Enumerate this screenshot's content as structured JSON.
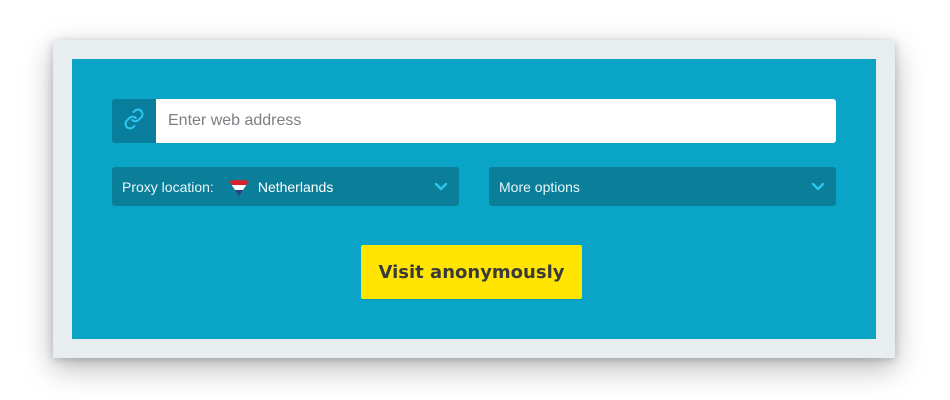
{
  "form": {
    "url_placeholder": "Enter web address",
    "url_value": "",
    "link_icon": "link-icon",
    "proxy_location": {
      "label": "Proxy location:",
      "selected": "Netherlands",
      "flag_icon": "netherlands-flag-icon"
    },
    "more_options": {
      "label": "More options"
    },
    "submit_label": "Visit anonymously"
  },
  "colors": {
    "panel": "#09a4c6",
    "dropdown": "#0b7f99",
    "link_box": "#087d9c",
    "button": "#ffe500",
    "chevron": "#2ec6ee"
  }
}
